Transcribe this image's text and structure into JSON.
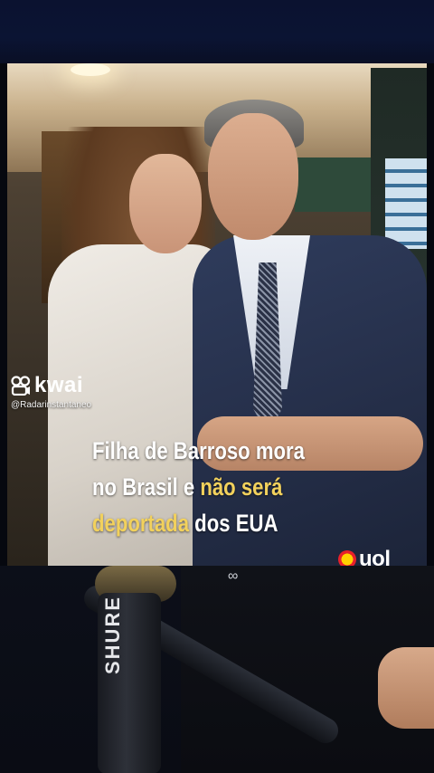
{
  "watermark": {
    "brand": "kwai",
    "username": "@Radarinstantaneo",
    "icon": "kwai-logo-icon"
  },
  "headline": {
    "line1": "Filha de Barroso mora",
    "line2_white": "no Brasil e ",
    "line2_yellow": "não será",
    "line3_yellow": "deportada",
    "line3_white": " dos EUA"
  },
  "source": {
    "brand": "uol",
    "icon": "uol-logo-icon"
  },
  "microphone": {
    "label": "SHURE"
  },
  "colors": {
    "highlight": "#f2d15c",
    "background": "#06080f"
  }
}
